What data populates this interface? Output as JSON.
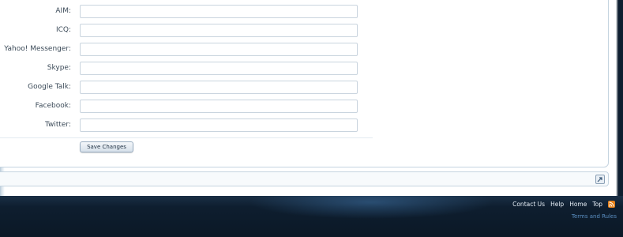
{
  "form": {
    "fields": [
      {
        "label": "AIM:",
        "value": ""
      },
      {
        "label": "ICQ:",
        "value": ""
      },
      {
        "label": "Yahoo! Messenger:",
        "value": ""
      },
      {
        "label": "Skype:",
        "value": ""
      },
      {
        "label": "Google Talk:",
        "value": ""
      },
      {
        "label": "Facebook:",
        "value": ""
      },
      {
        "label": "Twitter:",
        "value": ""
      }
    ],
    "save_label": "Save Changes"
  },
  "breadcrumb": {
    "jump_icon": "jump-icon"
  },
  "footer": {
    "links": [
      "Contact Us",
      "Help",
      "Home",
      "Top"
    ],
    "rss_icon": "rss-icon",
    "terms_label": "Terms and Rules",
    "colors": {
      "rss": "#e5811a",
      "terms": "#5b8fc2"
    }
  }
}
